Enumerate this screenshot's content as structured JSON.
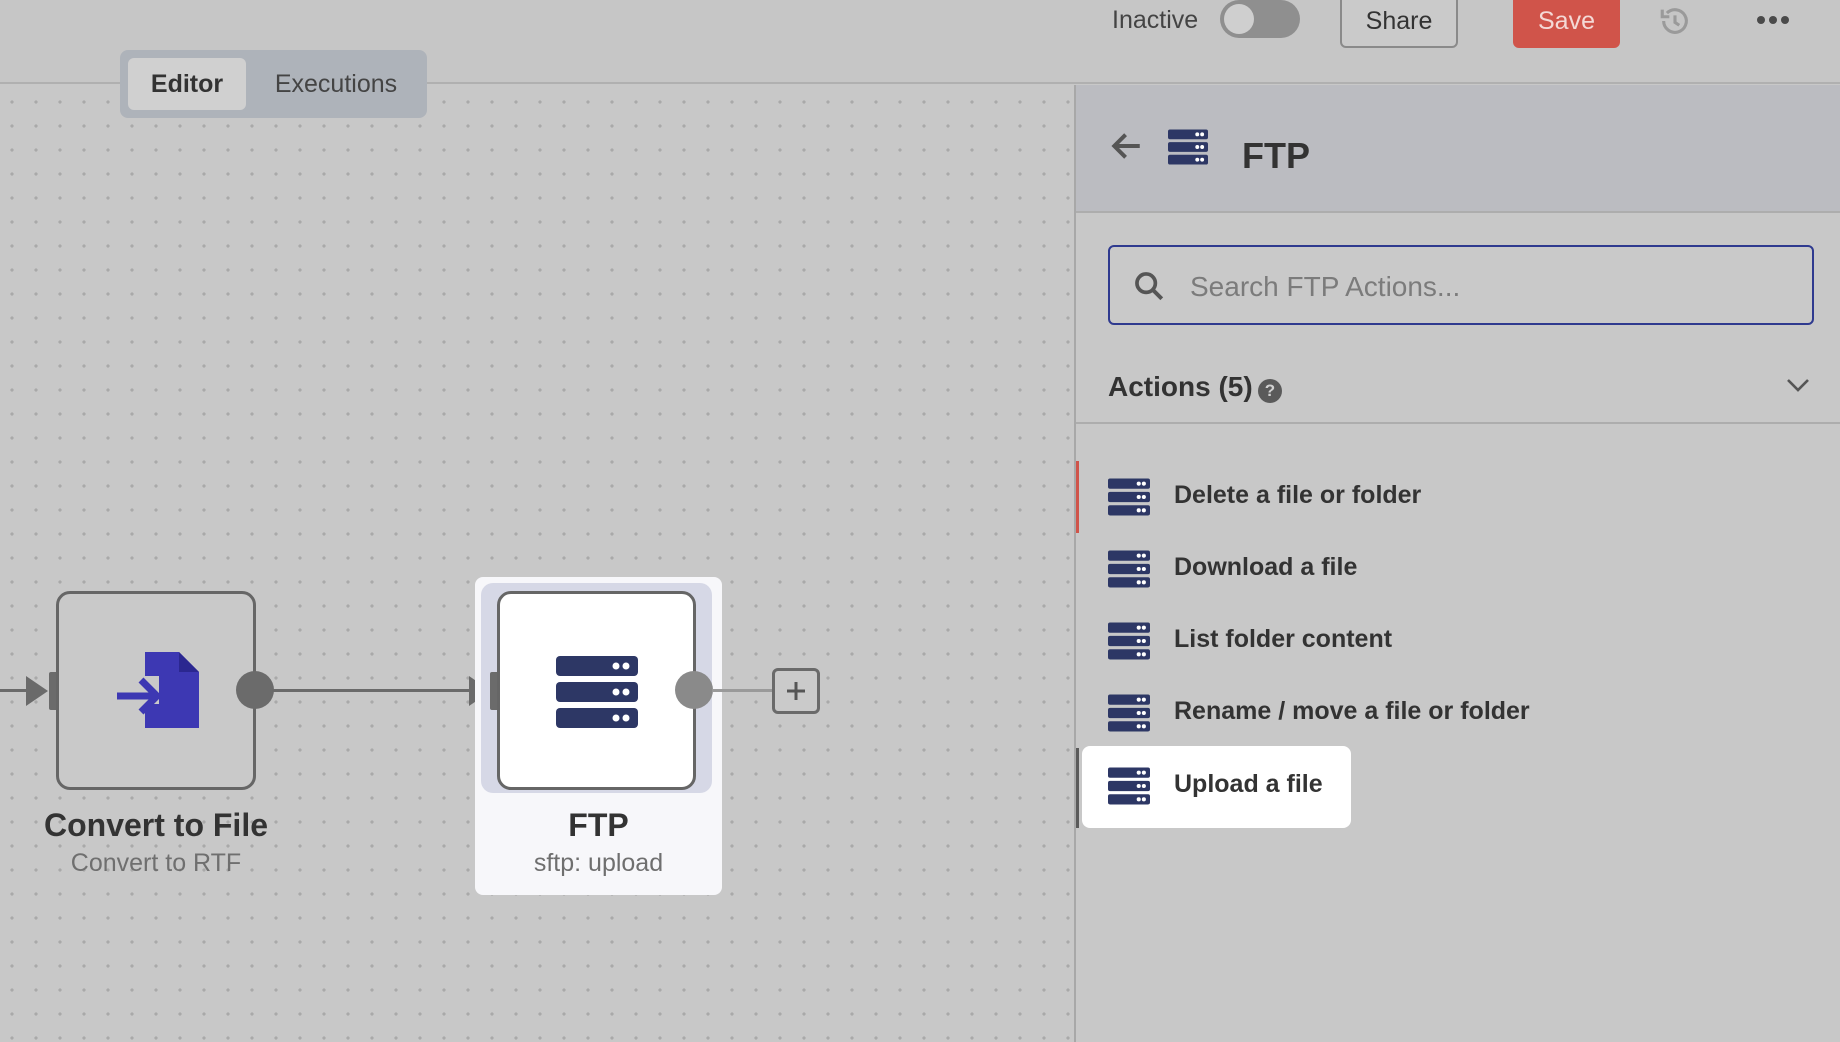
{
  "tabs": {
    "editor": "Editor",
    "executions": "Executions"
  },
  "header": {
    "status_label": "Inactive",
    "share_label": "Share",
    "save_label": "Save",
    "colors": {
      "save": "#d0544a"
    }
  },
  "canvas": {
    "nodes": [
      {
        "title": "Convert to File",
        "subtitle": "Convert to RTF",
        "icon": "file-import-icon"
      },
      {
        "title": "FTP",
        "subtitle": "sftp: upload",
        "icon": "server-icon"
      }
    ]
  },
  "panel": {
    "title": "FTP",
    "search_placeholder": "Search FTP Actions...",
    "actions_header": "Actions (5)",
    "actions": [
      {
        "label": "Delete a file or folder"
      },
      {
        "label": "Download a file"
      },
      {
        "label": "List folder content"
      },
      {
        "label": "Rename / move a file or folder"
      },
      {
        "label": "Upload a file"
      }
    ]
  }
}
